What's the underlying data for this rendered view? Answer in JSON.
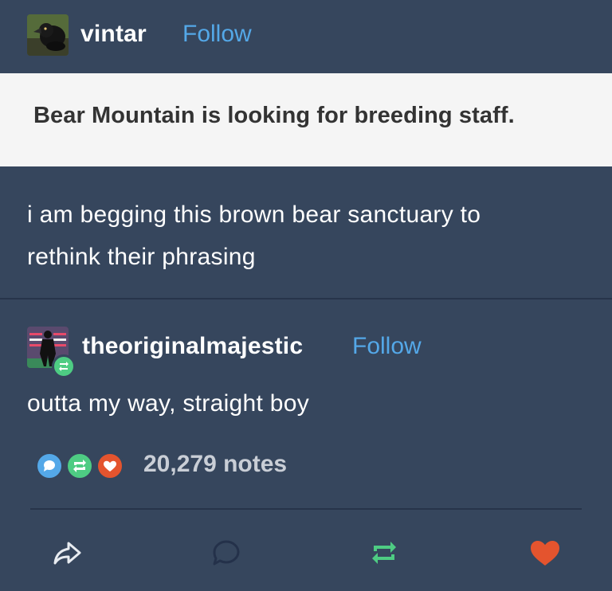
{
  "post": {
    "author": "vintar",
    "follow_label": "Follow",
    "quoted_text": "Bear Mountain is looking for breeding staff.",
    "body_line_1": "i am begging this brown bear sanctuary to",
    "body_line_2": "rethink their phrasing"
  },
  "reblog": {
    "author": "theoriginalmajestic",
    "follow_label": "Follow",
    "text": "outta my way, straight boy"
  },
  "notes": {
    "count_label": "20,279 notes",
    "icons": [
      "comment-icon",
      "reblog-icon",
      "like-icon"
    ]
  },
  "actions": [
    "share-icon",
    "reply-icon",
    "reblog-icon",
    "like-icon"
  ],
  "colors": {
    "background": "#36465d",
    "follow": "#54a8e8",
    "comment": "#54a8e8",
    "reblog": "#4ecc83",
    "like": "#e4542e"
  }
}
